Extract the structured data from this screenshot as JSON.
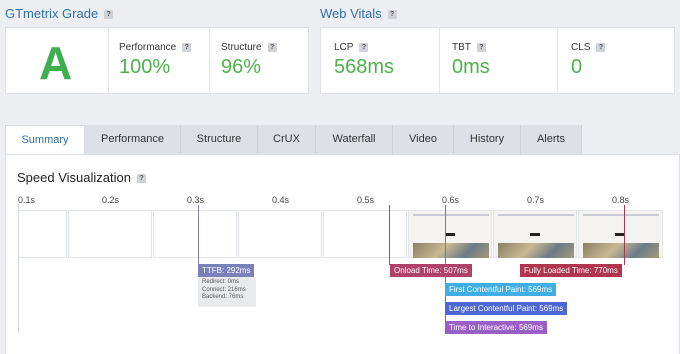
{
  "grade_section": {
    "title": "GTmetrix Grade",
    "help": "?"
  },
  "vitals_section": {
    "title": "Web Vitals",
    "help": "?"
  },
  "grade": {
    "letter": "A"
  },
  "performance": {
    "label": "Performance",
    "help": "?",
    "value": "100%"
  },
  "structure": {
    "label": "Structure",
    "help": "?",
    "value": "96%"
  },
  "lcp": {
    "label": "LCP",
    "help": "?",
    "value": "568ms"
  },
  "tbt": {
    "label": "TBT",
    "help": "?",
    "value": "0ms"
  },
  "cls": {
    "label": "CLS",
    "help": "?",
    "value": "0"
  },
  "tabs": [
    {
      "label": "Summary"
    },
    {
      "label": "Performance"
    },
    {
      "label": "Structure"
    },
    {
      "label": "CrUX"
    },
    {
      "label": "Waterfall"
    },
    {
      "label": "Video"
    },
    {
      "label": "History"
    },
    {
      "label": "Alerts"
    }
  ],
  "speed": {
    "title": "Speed Visualization",
    "help": "?",
    "ticks": [
      "0.1s",
      "0.2s",
      "0.3s",
      "0.4s",
      "0.5s",
      "0.6s",
      "0.7s",
      "0.8s"
    ],
    "ttfb": "TTFB: 292ms",
    "ttfb_details": {
      "redirect": "Redirect: 0ms",
      "connect": "Connect: 216ms",
      "backend": "Backend: 76ms"
    },
    "onload": "Onload Time: 507ms",
    "fully_loaded": "Fully Loaded Time: 770ms",
    "fcp": "First Contentful Paint: 569ms",
    "lcp": "Largest Contentful Paint: 569ms",
    "tti": "Time to Interactive: 569ms"
  },
  "colors": {
    "grade_green": "#3fae4e",
    "ttfb": "#7a81b8",
    "onload": "#b0426a",
    "fully_loaded": "#b0354f",
    "fcp": "#3faee6",
    "lcp": "#4e66d6",
    "tti": "#9a5fc4"
  }
}
